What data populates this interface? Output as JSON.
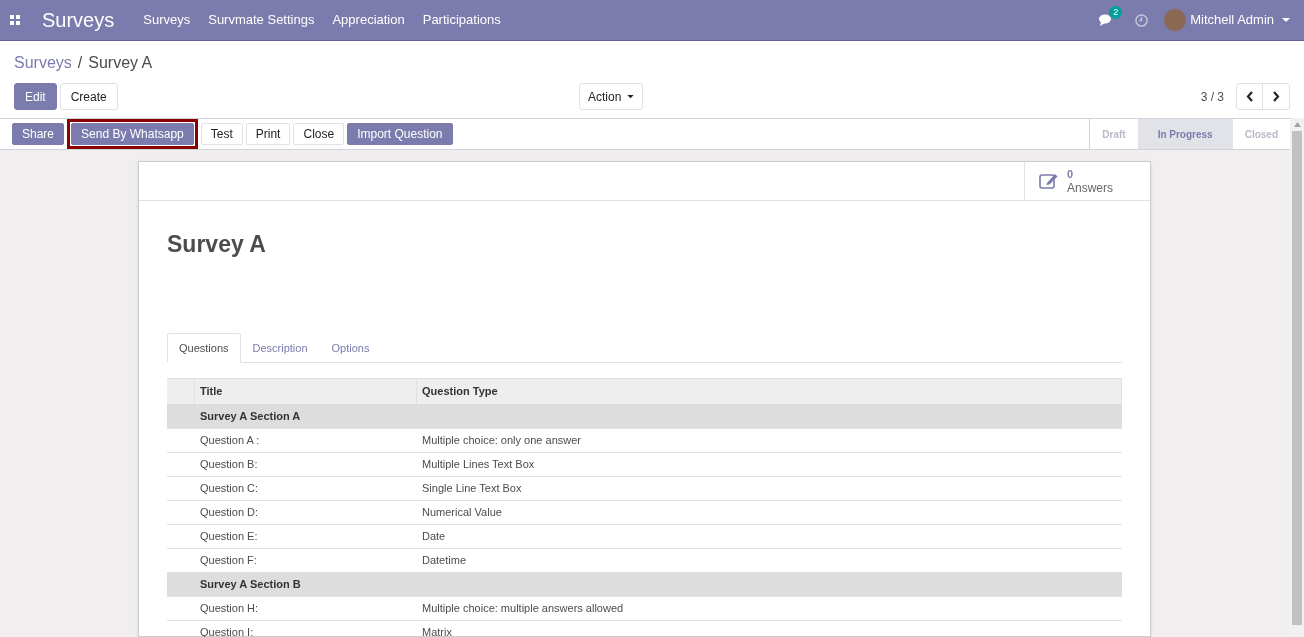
{
  "navbar": {
    "app_title": "Surveys",
    "menu": [
      "Surveys",
      "Survmate Settings",
      "Appreciation",
      "Participations"
    ],
    "messages_count": "2",
    "user": "Mitchell Admin"
  },
  "breadcrumb": {
    "separator": "/",
    "items": [
      {
        "label": "Surveys",
        "link": true
      },
      {
        "label": "Survey A",
        "link": false
      }
    ]
  },
  "control_buttons": [
    {
      "label": "Edit",
      "kind": "primary"
    },
    {
      "label": "Create",
      "kind": "secondary"
    }
  ],
  "action_menu": "Action",
  "pager": "3 / 3",
  "header_buttons": [
    {
      "label": "Share",
      "kind": "primary",
      "highlighted": false
    },
    {
      "label": "Send By Whatsapp",
      "kind": "primary",
      "highlighted": true
    },
    {
      "label": "Test",
      "kind": "secondary",
      "highlighted": false
    },
    {
      "label": "Print",
      "kind": "secondary",
      "highlighted": false
    },
    {
      "label": "Close",
      "kind": "secondary",
      "highlighted": false
    },
    {
      "label": "Import Question",
      "kind": "primary",
      "highlighted": false
    }
  ],
  "statusbar": [
    {
      "label": "Draft",
      "selected": false
    },
    {
      "label": "In Progress",
      "selected": true
    },
    {
      "label": "Closed",
      "selected": false
    }
  ],
  "stat_button": {
    "value": "0",
    "label": "Answers"
  },
  "title": "Survey A",
  "tabs": [
    {
      "label": "Questions",
      "selected": true
    },
    {
      "label": "Description",
      "selected": false
    },
    {
      "label": "Options",
      "selected": false
    }
  ],
  "table": {
    "columns": [
      "Title",
      "Question Type"
    ],
    "rows": [
      {
        "kind": "section",
        "title": "Survey A Section A"
      },
      {
        "kind": "question",
        "title": "Question A :",
        "type": "Multiple choice: only one answer"
      },
      {
        "kind": "question",
        "title": "Question B:",
        "type": "Multiple Lines Text Box"
      },
      {
        "kind": "question",
        "title": "Question C:",
        "type": "Single Line Text Box"
      },
      {
        "kind": "question",
        "title": "Question D:",
        "type": "Numerical Value"
      },
      {
        "kind": "question",
        "title": "Question E:",
        "type": "Date"
      },
      {
        "kind": "question",
        "title": "Question F:",
        "type": "Datetime"
      },
      {
        "kind": "section",
        "title": "Survey A Section B"
      },
      {
        "kind": "question",
        "title": "Question H:",
        "type": "Multiple choice: multiple answers allowed"
      },
      {
        "kind": "question",
        "title": "Question I:",
        "type": "Matrix"
      }
    ]
  }
}
